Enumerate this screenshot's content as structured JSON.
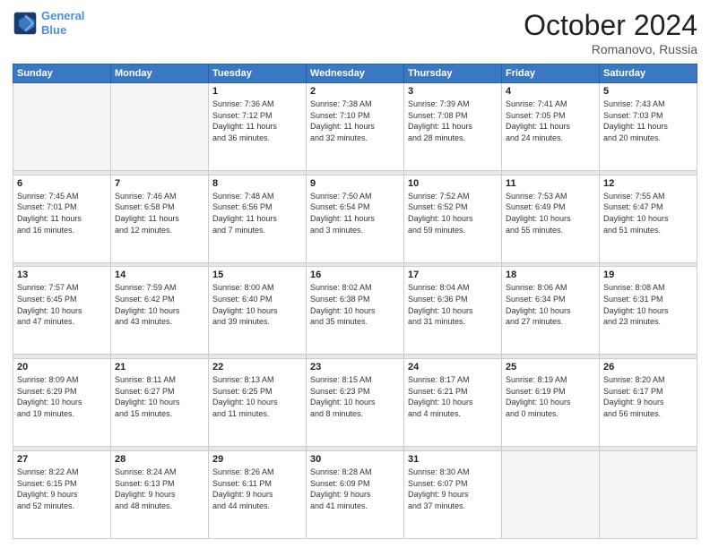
{
  "header": {
    "logo_line1": "General",
    "logo_line2": "Blue",
    "month": "October 2024",
    "location": "Romanovo, Russia"
  },
  "weekdays": [
    "Sunday",
    "Monday",
    "Tuesday",
    "Wednesday",
    "Thursday",
    "Friday",
    "Saturday"
  ],
  "weeks": [
    [
      {
        "day": "",
        "info": ""
      },
      {
        "day": "",
        "info": ""
      },
      {
        "day": "1",
        "info": "Sunrise: 7:36 AM\nSunset: 7:12 PM\nDaylight: 11 hours\nand 36 minutes."
      },
      {
        "day": "2",
        "info": "Sunrise: 7:38 AM\nSunset: 7:10 PM\nDaylight: 11 hours\nand 32 minutes."
      },
      {
        "day": "3",
        "info": "Sunrise: 7:39 AM\nSunset: 7:08 PM\nDaylight: 11 hours\nand 28 minutes."
      },
      {
        "day": "4",
        "info": "Sunrise: 7:41 AM\nSunset: 7:05 PM\nDaylight: 11 hours\nand 24 minutes."
      },
      {
        "day": "5",
        "info": "Sunrise: 7:43 AM\nSunset: 7:03 PM\nDaylight: 11 hours\nand 20 minutes."
      }
    ],
    [
      {
        "day": "6",
        "info": "Sunrise: 7:45 AM\nSunset: 7:01 PM\nDaylight: 11 hours\nand 16 minutes."
      },
      {
        "day": "7",
        "info": "Sunrise: 7:46 AM\nSunset: 6:58 PM\nDaylight: 11 hours\nand 12 minutes."
      },
      {
        "day": "8",
        "info": "Sunrise: 7:48 AM\nSunset: 6:56 PM\nDaylight: 11 hours\nand 7 minutes."
      },
      {
        "day": "9",
        "info": "Sunrise: 7:50 AM\nSunset: 6:54 PM\nDaylight: 11 hours\nand 3 minutes."
      },
      {
        "day": "10",
        "info": "Sunrise: 7:52 AM\nSunset: 6:52 PM\nDaylight: 10 hours\nand 59 minutes."
      },
      {
        "day": "11",
        "info": "Sunrise: 7:53 AM\nSunset: 6:49 PM\nDaylight: 10 hours\nand 55 minutes."
      },
      {
        "day": "12",
        "info": "Sunrise: 7:55 AM\nSunset: 6:47 PM\nDaylight: 10 hours\nand 51 minutes."
      }
    ],
    [
      {
        "day": "13",
        "info": "Sunrise: 7:57 AM\nSunset: 6:45 PM\nDaylight: 10 hours\nand 47 minutes."
      },
      {
        "day": "14",
        "info": "Sunrise: 7:59 AM\nSunset: 6:42 PM\nDaylight: 10 hours\nand 43 minutes."
      },
      {
        "day": "15",
        "info": "Sunrise: 8:00 AM\nSunset: 6:40 PM\nDaylight: 10 hours\nand 39 minutes."
      },
      {
        "day": "16",
        "info": "Sunrise: 8:02 AM\nSunset: 6:38 PM\nDaylight: 10 hours\nand 35 minutes."
      },
      {
        "day": "17",
        "info": "Sunrise: 8:04 AM\nSunset: 6:36 PM\nDaylight: 10 hours\nand 31 minutes."
      },
      {
        "day": "18",
        "info": "Sunrise: 8:06 AM\nSunset: 6:34 PM\nDaylight: 10 hours\nand 27 minutes."
      },
      {
        "day": "19",
        "info": "Sunrise: 8:08 AM\nSunset: 6:31 PM\nDaylight: 10 hours\nand 23 minutes."
      }
    ],
    [
      {
        "day": "20",
        "info": "Sunrise: 8:09 AM\nSunset: 6:29 PM\nDaylight: 10 hours\nand 19 minutes."
      },
      {
        "day": "21",
        "info": "Sunrise: 8:11 AM\nSunset: 6:27 PM\nDaylight: 10 hours\nand 15 minutes."
      },
      {
        "day": "22",
        "info": "Sunrise: 8:13 AM\nSunset: 6:25 PM\nDaylight: 10 hours\nand 11 minutes."
      },
      {
        "day": "23",
        "info": "Sunrise: 8:15 AM\nSunset: 6:23 PM\nDaylight: 10 hours\nand 8 minutes."
      },
      {
        "day": "24",
        "info": "Sunrise: 8:17 AM\nSunset: 6:21 PM\nDaylight: 10 hours\nand 4 minutes."
      },
      {
        "day": "25",
        "info": "Sunrise: 8:19 AM\nSunset: 6:19 PM\nDaylight: 10 hours\nand 0 minutes."
      },
      {
        "day": "26",
        "info": "Sunrise: 8:20 AM\nSunset: 6:17 PM\nDaylight: 9 hours\nand 56 minutes."
      }
    ],
    [
      {
        "day": "27",
        "info": "Sunrise: 8:22 AM\nSunset: 6:15 PM\nDaylight: 9 hours\nand 52 minutes."
      },
      {
        "day": "28",
        "info": "Sunrise: 8:24 AM\nSunset: 6:13 PM\nDaylight: 9 hours\nand 48 minutes."
      },
      {
        "day": "29",
        "info": "Sunrise: 8:26 AM\nSunset: 6:11 PM\nDaylight: 9 hours\nand 44 minutes."
      },
      {
        "day": "30",
        "info": "Sunrise: 8:28 AM\nSunset: 6:09 PM\nDaylight: 9 hours\nand 41 minutes."
      },
      {
        "day": "31",
        "info": "Sunrise: 8:30 AM\nSunset: 6:07 PM\nDaylight: 9 hours\nand 37 minutes."
      },
      {
        "day": "",
        "info": ""
      },
      {
        "day": "",
        "info": ""
      }
    ]
  ]
}
